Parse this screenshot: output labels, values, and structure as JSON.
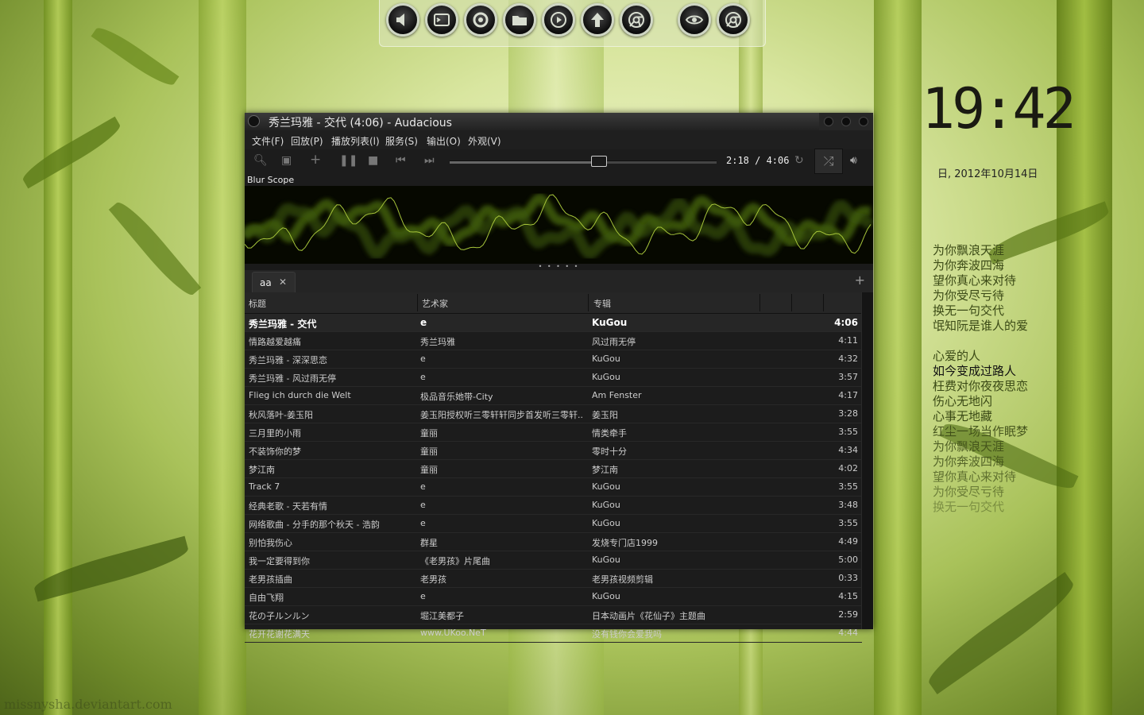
{
  "dock": {
    "items": [
      "speaker-icon",
      "terminal-icon",
      "settings-icon",
      "file-manager-icon",
      "media-play-icon",
      "home-up-icon",
      "browser-icon",
      "eye-icon",
      "chrome-icon"
    ]
  },
  "desktop": {
    "clock": "19:42",
    "date": "日, 2012年10月14日",
    "lyrics_a": [
      "为你飘浪天涯",
      "为你奔波四海",
      "望你真心来对待",
      "为你受尽亏待",
      "换无一句交代",
      "氓知阮是谁人的爱"
    ],
    "lyrics_b": [
      "心爱的人",
      "如今变成过路人",
      "枉费对你夜夜思恋",
      "伤心无地闪",
      "心事无地藏",
      "红尘一场当作眠梦",
      "为你飘浪天涯",
      "为你奔波四海",
      "望你真心来对待",
      "为你受尽亏待",
      "换无一句交代"
    ],
    "watermark": "missnysha.deviantart.com"
  },
  "player": {
    "title": "秀兰玛雅 - 交代 (4:06) - Audacious",
    "menu": [
      "文件(F)",
      "回放(P)",
      "播放列表(l)",
      "服务(S)",
      "输出(O)",
      "外观(V)"
    ],
    "time": "2:18 / 4:06",
    "progress": 0.56,
    "visualizer_label": "Blur Scope",
    "tab_label": "aa",
    "columns": [
      "标题",
      "艺术家",
      "专辑"
    ],
    "colors": {
      "accent_green": "#7fa81f",
      "window_bg": "#1c1c1c"
    },
    "tracks": [
      {
        "title": "秀兰玛雅 - 交代",
        "artist": "e",
        "album": "KuGou",
        "time": "4:06"
      },
      {
        "title": "情路越爱越痛",
        "artist": "秀兰玛雅",
        "album": "风过雨无停",
        "time": "4:11"
      },
      {
        "title": "秀兰玛雅 - 深深思恋",
        "artist": "e",
        "album": "KuGou",
        "time": "4:32"
      },
      {
        "title": "秀兰玛雅 - 风过雨无停",
        "artist": "e",
        "album": "KuGou",
        "time": "3:57"
      },
      {
        "title": "Flieg ich durch die Welt",
        "artist": "极品音乐她带-City",
        "album": "Am Fenster",
        "time": "4:17"
      },
      {
        "title": "秋风落叶-姜玉阳",
        "artist": "姜玉阳授权听三零轩轩同步首发听三零轩...",
        "album": "姜玉阳",
        "time": "3:28"
      },
      {
        "title": "三月里的小雨",
        "artist": "童丽",
        "album": "情类牵手",
        "time": "3:55"
      },
      {
        "title": "不装饰你的梦",
        "artist": "童丽",
        "album": "零时十分",
        "time": "4:34"
      },
      {
        "title": "梦江南",
        "artist": "童丽",
        "album": "梦江南",
        "time": "4:02"
      },
      {
        "title": "Track 7",
        "artist": "e",
        "album": "KuGou",
        "time": "3:55"
      },
      {
        "title": "经典老歌 - 天若有情",
        "artist": "e",
        "album": "KuGou",
        "time": "3:48"
      },
      {
        "title": "网络歌曲 - 分手的那个秋天 - 浩韵",
        "artist": "e",
        "album": "KuGou",
        "time": "3:55"
      },
      {
        "title": "别怕我伤心",
        "artist": "群星",
        "album": "发烧专门店1999",
        "time": "4:49"
      },
      {
        "title": "我一定要得到你",
        "artist": "《老男孩》片尾曲",
        "album": "KuGou",
        "time": "5:00"
      },
      {
        "title": "老男孩插曲",
        "artist": "老男孩",
        "album": "老男孩视频剪辑",
        "time": "0:33"
      },
      {
        "title": "自由飞翔",
        "artist": "e",
        "album": "KuGou",
        "time": "4:15"
      },
      {
        "title": "花の子ルンルン",
        "artist": "堀江美都子",
        "album": "日本动画片《花仙子》主题曲",
        "time": "2:59"
      },
      {
        "title": "花开花谢花满天",
        "artist": "www.UKoo.NeT",
        "album": "没有钱你会爱我吗",
        "time": "4:44"
      }
    ]
  }
}
